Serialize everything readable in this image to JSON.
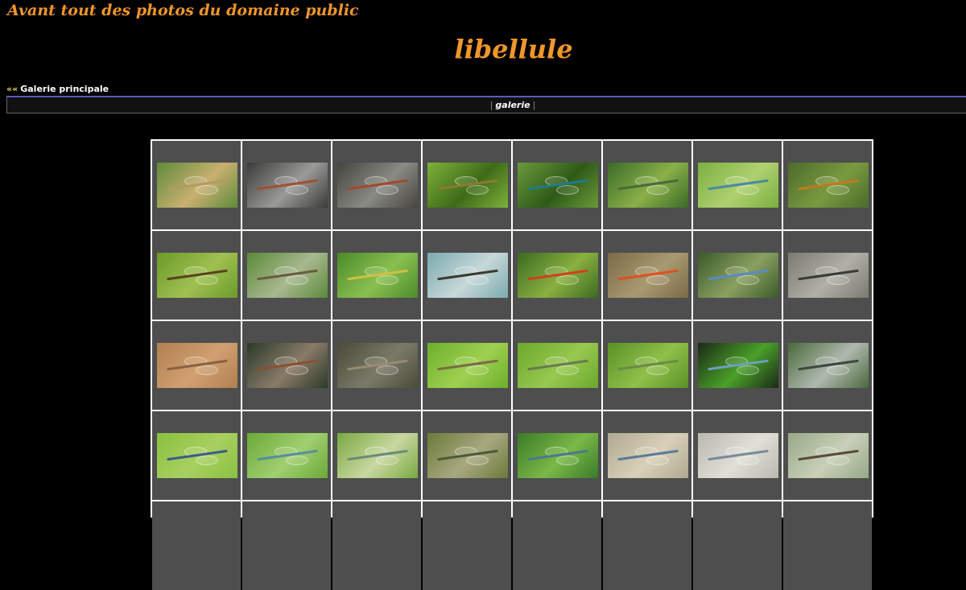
{
  "header": {
    "site_title": "Avant tout des photos du domaine public",
    "page_title": "libellule"
  },
  "nav": {
    "back_arrows": "««",
    "back_label": "Galerie principale",
    "sep_left": "|",
    "current": "galerie",
    "sep_right": "|"
  },
  "gallery": {
    "rows": [
      [
        {
          "bg": "#5f8a3a",
          "fg": "#c8b070",
          "body": "#b49a60"
        },
        {
          "bg": "#3a3a38",
          "fg": "#9a9a98",
          "body": "#a05030"
        },
        {
          "bg": "#45443f",
          "fg": "#8a8a85",
          "body": "#a04a2a"
        },
        {
          "bg": "#7db23a",
          "fg": "#3e6a18",
          "body": "#8a7a30"
        },
        {
          "bg": "#6a9a3a",
          "fg": "#2e5a18",
          "body": "#1f7a8a"
        },
        {
          "bg": "#3a6a28",
          "fg": "#8ab048",
          "body": "#4a6a3a"
        },
        {
          "bg": "#7ab040",
          "fg": "#b0d070",
          "body": "#4a8aa0"
        },
        {
          "bg": "#4a6a2a",
          "fg": "#7a9a40",
          "body": "#c07a20"
        }
      ],
      [
        {
          "bg": "#6a9a2a",
          "fg": "#a0c050",
          "body": "#5a4020"
        },
        {
          "bg": "#5a8a38",
          "fg": "#a8b890",
          "body": "#6a5a40"
        },
        {
          "bg": "#4a8a2a",
          "fg": "#8ac050",
          "body": "#d0c040"
        },
        {
          "bg": "#7aaab0",
          "fg": "#c8d8d8",
          "body": "#3a3a30"
        },
        {
          "bg": "#3a6a20",
          "fg": "#8ab040",
          "body": "#d04020"
        },
        {
          "bg": "#7a6a48",
          "fg": "#a89a70",
          "body": "#e05020"
        },
        {
          "bg": "#3a5a2a",
          "fg": "#8aa060",
          "body": "#5a8ac0"
        },
        {
          "bg": "#7a7a70",
          "fg": "#b0b0a8",
          "body": "#3a3a38"
        }
      ],
      [
        {
          "bg": "#b08050",
          "fg": "#d0a070",
          "body": "#8a6040"
        },
        {
          "bg": "#2a3a28",
          "fg": "#8a7a68",
          "body": "#8a5030"
        },
        {
          "bg": "#4a4a38",
          "fg": "#7a7a68",
          "body": "#9a8a70"
        },
        {
          "bg": "#6ab02a",
          "fg": "#a0d050",
          "body": "#7a6a48"
        },
        {
          "bg": "#6aa82a",
          "fg": "#98c850",
          "body": "#6a7a50"
        },
        {
          "bg": "#5a9028",
          "fg": "#90c048",
          "body": "#6a8a4a"
        },
        {
          "bg": "#1a2a18",
          "fg": "#4aa028",
          "body": "#6aa0c0"
        },
        {
          "bg": "#4a6a3a",
          "fg": "#b0b8b0",
          "body": "#3a4a40"
        }
      ],
      [
        {
          "bg": "#8ac040",
          "fg": "#a8d060",
          "body": "#3a5a8a"
        },
        {
          "bg": "#6aa838",
          "fg": "#a0d070",
          "body": "#5a8aa0"
        },
        {
          "bg": "#7aa840",
          "fg": "#c8d8a0",
          "body": "#6a8a7a"
        },
        {
          "bg": "#6a7a38",
          "fg": "#a8a880",
          "body": "#4a5a3a"
        },
        {
          "bg": "#3a7a28",
          "fg": "#7ab848",
          "body": "#4a7a8a"
        },
        {
          "bg": "#b0a890",
          "fg": "#d8d0b8",
          "body": "#5a7a9a"
        },
        {
          "bg": "#b8b8b0",
          "fg": "#e0e0d8",
          "body": "#7a8a98"
        },
        {
          "bg": "#98a888",
          "fg": "#c8d0b8",
          "body": "#5a4a38"
        }
      ],
      [
        {
          "bg": "#4e4e4e",
          "fg": "#4e4e4e",
          "body": "#4e4e4e"
        },
        {
          "bg": "#4e4e4e",
          "fg": "#4e4e4e",
          "body": "#4e4e4e"
        },
        {
          "bg": "#4e4e4e",
          "fg": "#4e4e4e",
          "body": "#4e4e4e"
        },
        {
          "bg": "#4e4e4e",
          "fg": "#4e4e4e",
          "body": "#4e4e4e"
        },
        {
          "bg": "#4e4e4e",
          "fg": "#4e4e4e",
          "body": "#4e4e4e"
        },
        {
          "bg": "#4e4e4e",
          "fg": "#4e4e4e",
          "body": "#4e4e4e"
        },
        {
          "bg": "#4e4e4e",
          "fg": "#4e4e4e",
          "body": "#4e4e4e"
        },
        {
          "bg": "#4e4e4e",
          "fg": "#4e4e4e",
          "body": "#4e4e4e"
        }
      ]
    ]
  }
}
